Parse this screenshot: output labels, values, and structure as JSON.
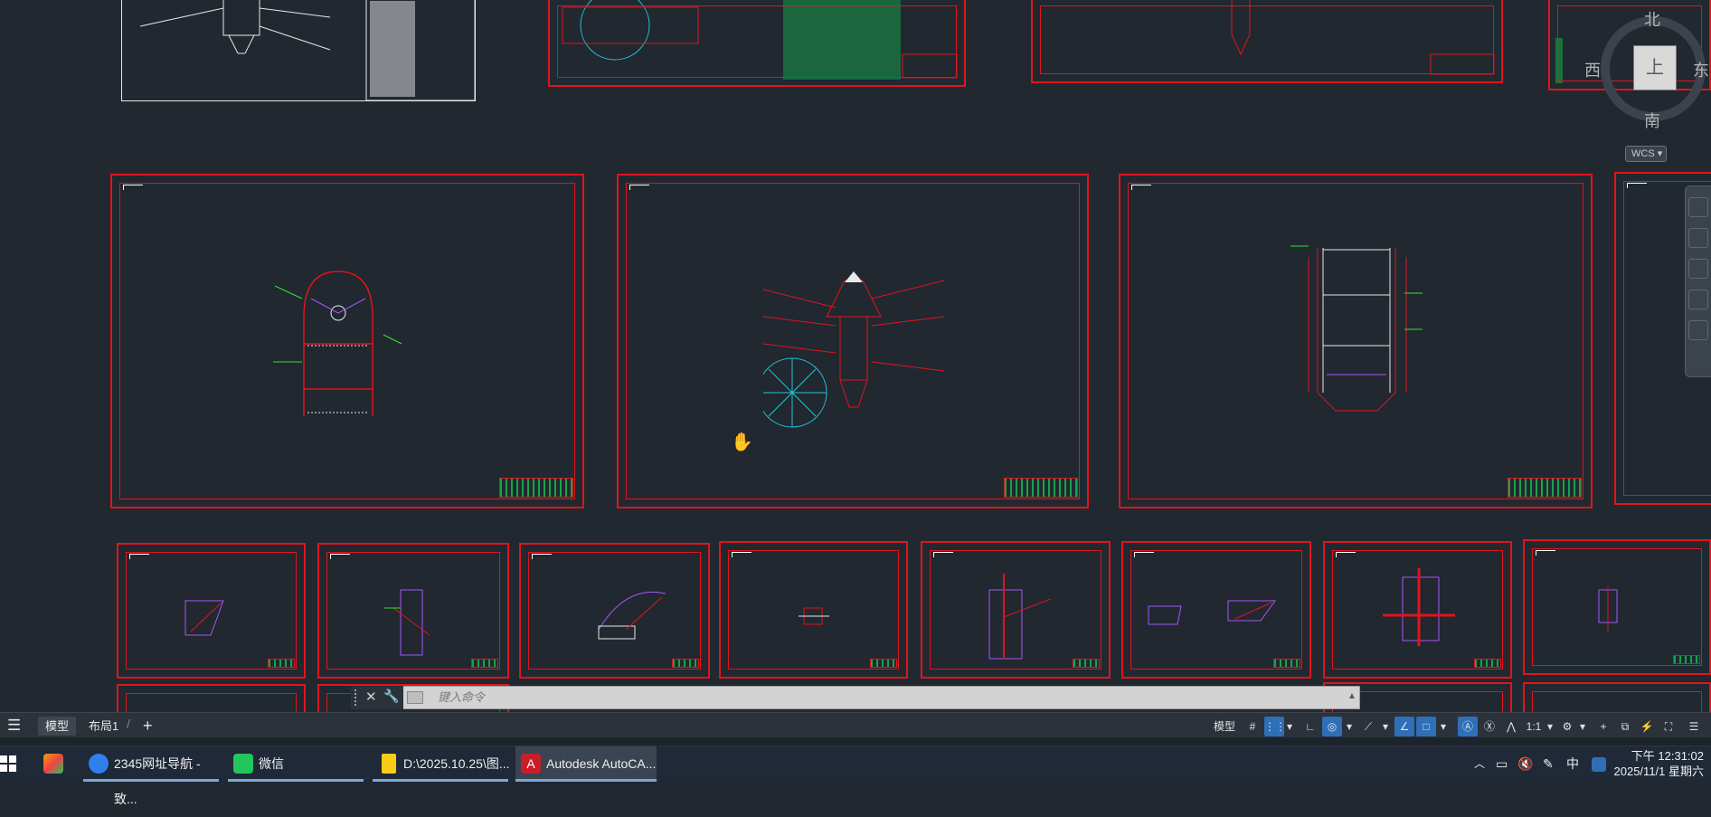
{
  "viewcube": {
    "top_label": "上",
    "north": "北",
    "south": "南",
    "east": "东",
    "west": "西",
    "wcs": "WCS"
  },
  "command": {
    "placeholder": "键入命令"
  },
  "layout_tabs": {
    "model": "模型",
    "layout1": "布局1",
    "add": "+"
  },
  "statusbar": {
    "model": "模型",
    "scale": "1:1"
  },
  "taskbar": {
    "items": [
      {
        "label": "2345网址导航 - 致..."
      },
      {
        "label": "微信"
      },
      {
        "label": "D:\\2025.10.25\\图..."
      },
      {
        "label": "Autodesk AutoCA..."
      }
    ],
    "ime": "中",
    "clock_time": "下午 12:31:02",
    "clock_date": "2025/11/1 星期六"
  },
  "colors": {
    "canvas": "#212830",
    "frame": "#e0141c",
    "accent": "#2f6fb8"
  }
}
